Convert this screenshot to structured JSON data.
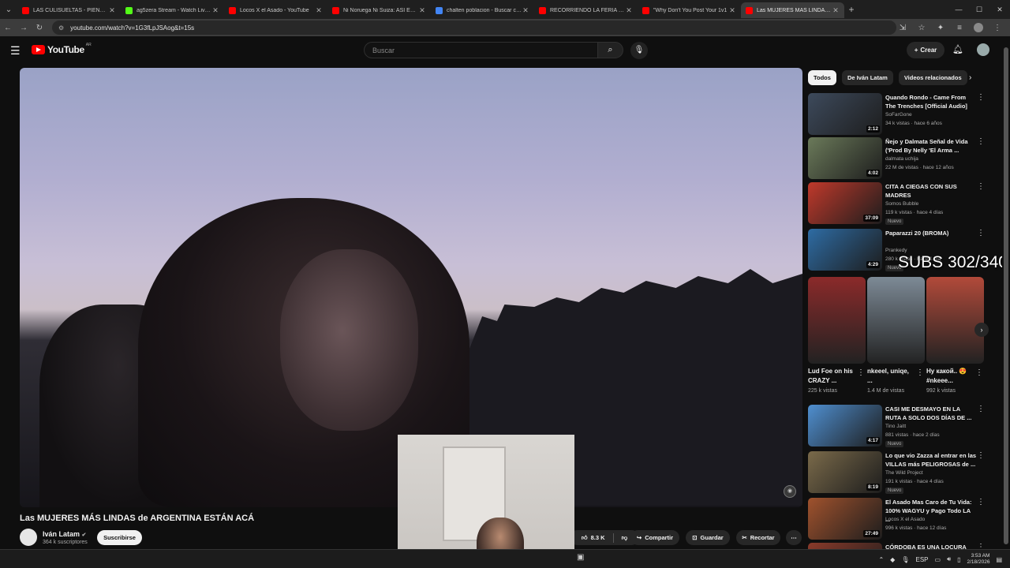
{
  "browser": {
    "tabs": [
      {
        "title": "LAS CULISUELTAS - PIENSO EN",
        "color": "#ff0000",
        "active": false
      },
      {
        "title": "ag5zera Stream - Watch Live o",
        "color": "#53fc18",
        "active": false
      },
      {
        "title": "Locos X el Asado - YouTube",
        "color": "#ff0000",
        "active": false
      },
      {
        "title": "Ni Noruega Ni Suiza: ASI ES A",
        "color": "#ff0000",
        "active": false
      },
      {
        "title": "chalten poblacion - Buscar con",
        "color": "#4285f4",
        "active": false
      },
      {
        "title": "RECORRIENDO LA FERIA DE S",
        "color": "#ff0000",
        "active": false
      },
      {
        "title": "\"Why Don't You Post Your 1v1",
        "color": "#ff0000",
        "active": false
      },
      {
        "title": "Las MUJERES MÁS LINDAS de",
        "color": "#ff0000",
        "active": true
      }
    ],
    "url": "youtube.com/watch?v=1G3fLpJSAog&t=15s"
  },
  "masthead": {
    "logo_text": "YouTube",
    "country_code": "AR",
    "search_placeholder": "Buscar",
    "create_label": "Crear"
  },
  "video": {
    "title": "Las MUJERES MÁS LINDAS de ARGENTINA ESTÁN ACÁ",
    "channel": "Iván Latam",
    "subscribers": "364 k suscriptores",
    "subscribe_label": "Suscribirse",
    "likes": "8.3 K",
    "share_label": "Compartir",
    "save_label": "Guardar",
    "clip_label": "Recortar"
  },
  "overlay": {
    "subs_text": "SUBS 302/340"
  },
  "sidebar": {
    "chips": [
      "Todos",
      "De Iván Latam",
      "Videos relacionados"
    ],
    "recommendations": [
      {
        "title": "Quando Rondo - Came From The Trenches [Official Audio]",
        "channel": "SoFarGone",
        "meta": "34 k vistas · hace 6 años",
        "duration": "2:12",
        "badge": "",
        "thumb": "#3d4a5c"
      },
      {
        "title": "Ñejo y Dalmata   Señal de Vida ('Prod By Nelly 'El Arma ...",
        "channel": "dalmata uchija",
        "meta": "22 M de vistas · hace 12 años",
        "duration": "4:02",
        "badge": "",
        "thumb": "#6b7a5a"
      },
      {
        "title": "CITA A CIEGAS CON SUS MADRES",
        "channel": "Somos Bubble",
        "meta": "119 k vistas · hace 4 días",
        "duration": "37:09",
        "badge": "Nuevo",
        "thumb": "#c0392b"
      },
      {
        "title": "Paparazzi 20 (BROMA)",
        "channel": "Prankedy",
        "meta": "280 k vistas · hace 1 día",
        "duration": "4:29",
        "badge": "Nuevo",
        "thumb": "#2e6ca4"
      },
      {
        "title": "CASI ME DESMAYO EN LA RUTA A SOLO DOS DÍAS DE ...",
        "channel": "Tino Jaitt",
        "meta": "881 vistas · hace 2 días",
        "duration": "4:17",
        "badge": "Nuevo",
        "thumb": "#4f8fd0"
      },
      {
        "title": "Lo que vio Zazza al entrar en las VILLAS más PELIGROSAS de ...",
        "channel": "The Wild Project",
        "meta": "191 k vistas · hace 4 días",
        "duration": "8:19",
        "badge": "Nuevo",
        "thumb": "#7a6a4a"
      },
      {
        "title": "El Asado Mas Caro de Tu Vida: 100% WAGYU y Pago Todo LA ...",
        "channel": "Locos X el Asado",
        "meta": "996 k vistas · hace 12 días",
        "duration": "27:49",
        "badge": "",
        "thumb": "#a0522d"
      },
      {
        "title": "CÓRDOBA ES UNA LOCURA",
        "channel": "",
        "meta": "",
        "duration": "",
        "badge": "",
        "thumb": "#8a3a2a"
      }
    ],
    "shorts": [
      {
        "title": "Lud Foe on his CRAZY ...",
        "views": "225 k vistas",
        "thumb": "#8b2a2a"
      },
      {
        "title": "nkeeel, uniqe, ...",
        "views": "1.4 M de vistas",
        "thumb": "#7d8a96"
      },
      {
        "title": "Ну какой.. 😍 #nkeee...",
        "views": "992 k vistas",
        "thumb": "#b24a3a"
      }
    ]
  },
  "taskbar": {
    "lang": "ESP",
    "time": "3:53 AM",
    "date": "2/18/2026"
  }
}
